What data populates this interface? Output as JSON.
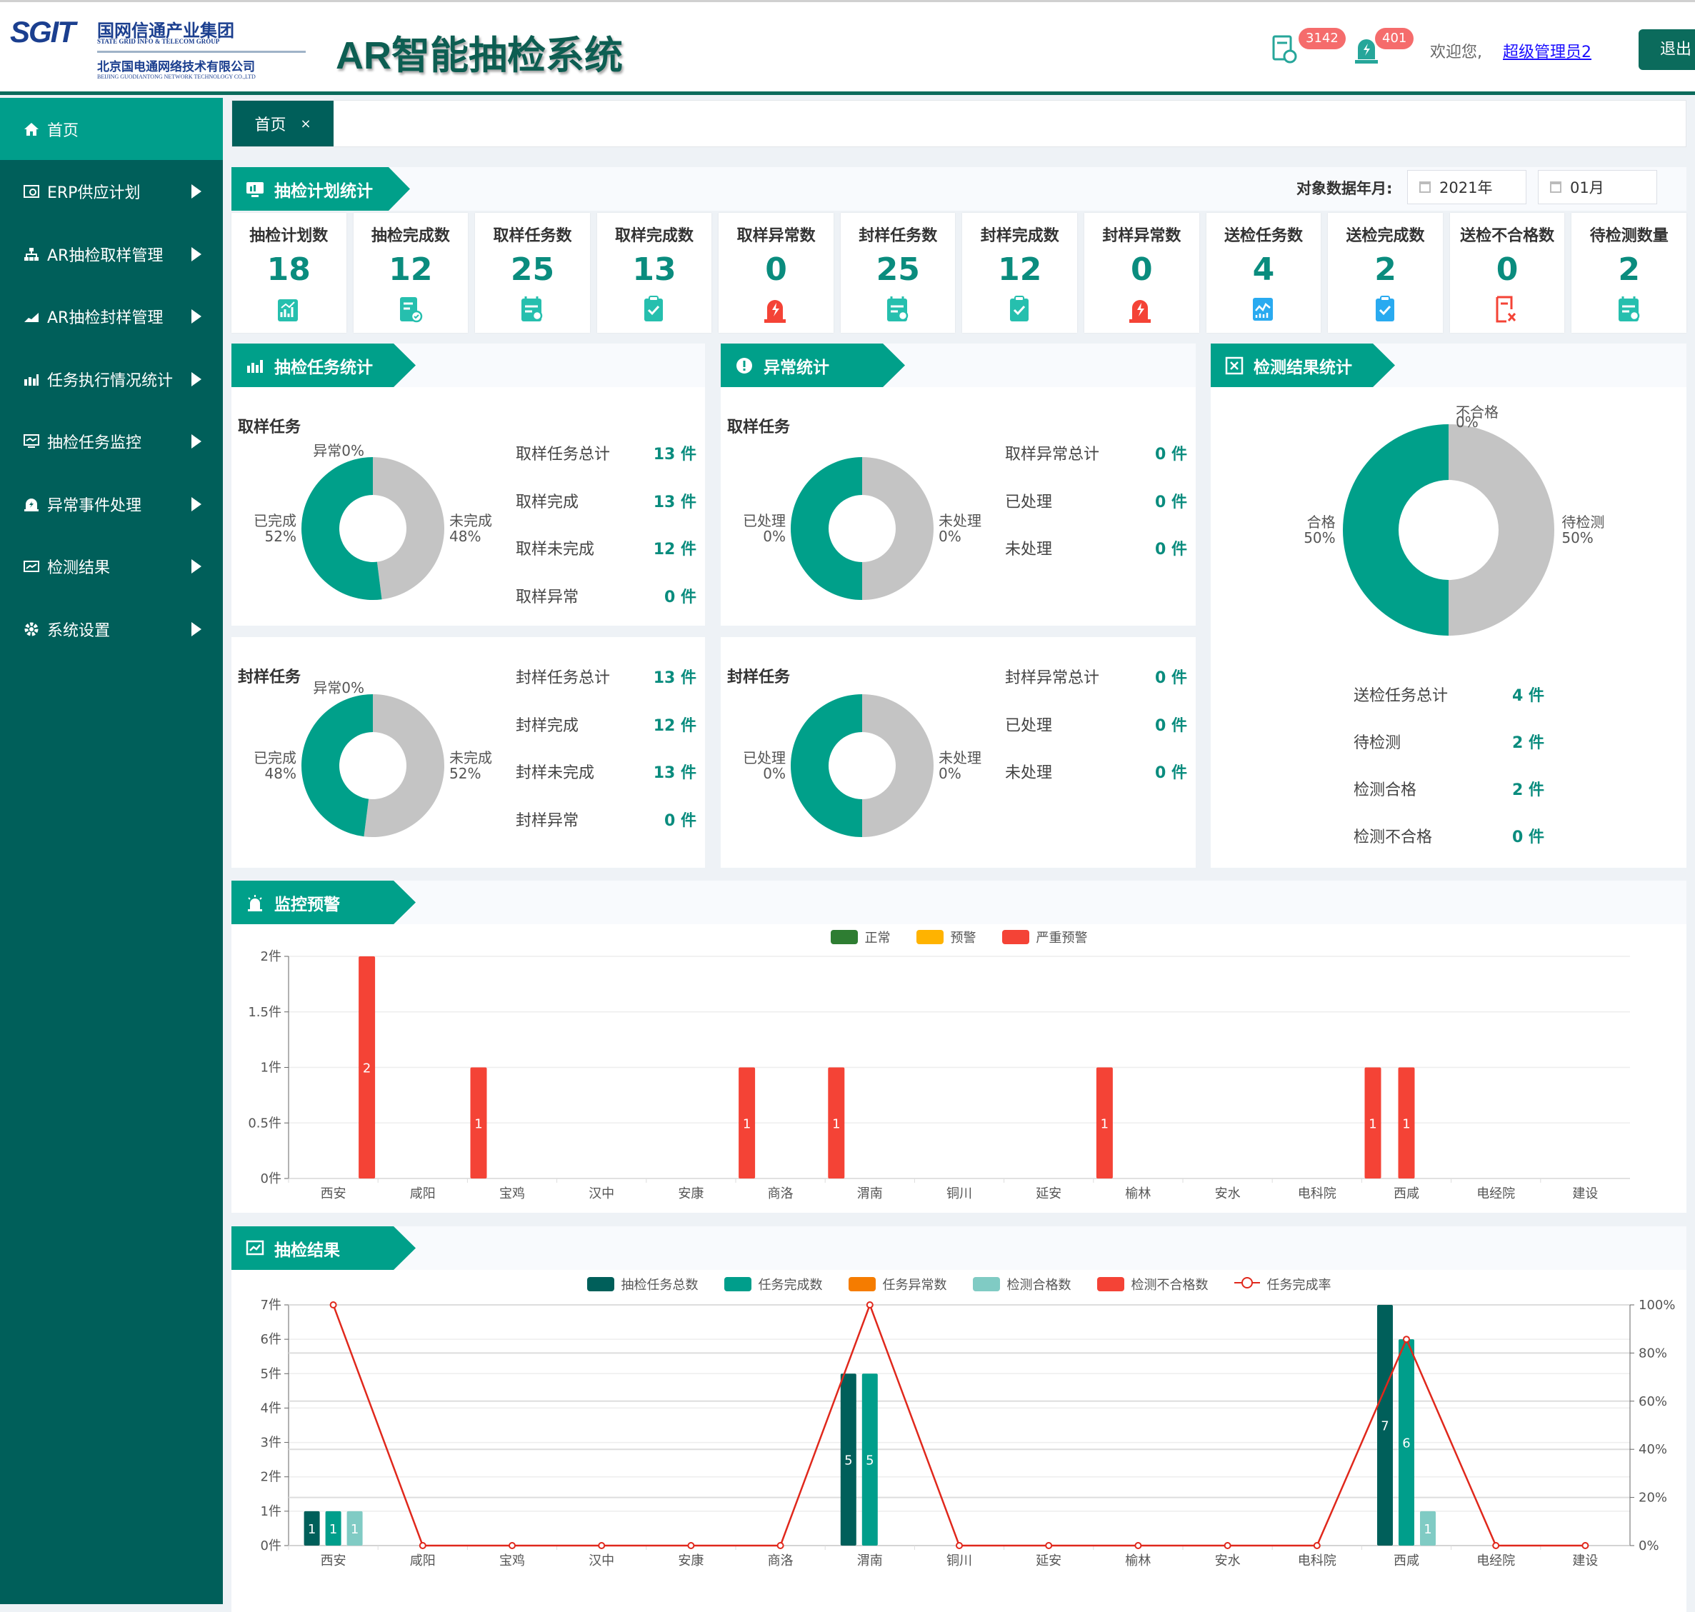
{
  "header": {
    "logo_mark": "SGIT",
    "logo_group_cn": "国网信通产业集团",
    "logo_group_en": "STATE GRID INFO & TELECOM GROUP",
    "logo_company_cn": "北京国电通网络技术有限公司",
    "logo_company_en": "BEIJING GUODIANTONG NETWORK TECHNOLOGY CO.,LTD",
    "title": "AR智能抽检系统",
    "task_badge": "3142",
    "alarm_badge": "401",
    "welcome": "欢迎您,",
    "user": "超级管理员2",
    "logout": "退出"
  },
  "sidebar": {
    "items": [
      {
        "label": "首页",
        "icon": "home-icon",
        "active": true
      },
      {
        "label": "ERP供应计划",
        "icon": "erp-icon"
      },
      {
        "label": "AR抽检取样管理",
        "icon": "org-chart-icon"
      },
      {
        "label": "AR抽检封样管理",
        "icon": "area-chart-icon"
      },
      {
        "label": "任务执行情况统计",
        "icon": "bar-chart-icon"
      },
      {
        "label": "抽检任务监控",
        "icon": "monitor-icon"
      },
      {
        "label": "异常事件处理",
        "icon": "alarm-icon"
      },
      {
        "label": "检测结果",
        "icon": "line-chart-icon"
      },
      {
        "label": "系统设置",
        "icon": "gear-icon"
      }
    ]
  },
  "tabs": [
    {
      "label": "首页",
      "close": "×"
    }
  ],
  "plan_stats": {
    "title": "抽检计划统计",
    "date_label": "对象数据年月:",
    "year": "2021年",
    "month": "01月",
    "cards": [
      {
        "label": "抽检计划数",
        "value": "18",
        "icon": "plan-chart-icon",
        "color": "#26bfae"
      },
      {
        "label": "抽检完成数",
        "value": "12",
        "icon": "doc-check-icon",
        "color": "#26bfae"
      },
      {
        "label": "取样任务数",
        "value": "25",
        "icon": "calendar-icon",
        "color": "#26bfae"
      },
      {
        "label": "取样完成数",
        "value": "13",
        "icon": "clipboard-check-icon",
        "color": "#26bfae"
      },
      {
        "label": "取样异常数",
        "value": "0",
        "icon": "alarm-light-icon",
        "color": "#f44336"
      },
      {
        "label": "封样任务数",
        "value": "25",
        "icon": "calendar-icon",
        "color": "#26bfae"
      },
      {
        "label": "封样完成数",
        "value": "12",
        "icon": "clipboard-check-icon",
        "color": "#26bfae"
      },
      {
        "label": "封样异常数",
        "value": "0",
        "icon": "alarm-light-icon",
        "color": "#f44336"
      },
      {
        "label": "送检任务数",
        "value": "4",
        "icon": "chart-board-icon",
        "color": "#29aaf0"
      },
      {
        "label": "送检完成数",
        "value": "2",
        "icon": "clipboard-check-icon",
        "color": "#29aaf0"
      },
      {
        "label": "送检不合格数",
        "value": "0",
        "icon": "doc-x-icon",
        "color": "#f44336"
      },
      {
        "label": "待检测数量",
        "value": "2",
        "icon": "calendar-icon",
        "color": "#26bfae"
      }
    ]
  },
  "task_stats": {
    "title": "抽检任务统计",
    "blocks": [
      {
        "title": "取样任务",
        "pie": {
          "left_label": "已完成",
          "left_pct": "52%",
          "left_value": 52,
          "right_label": "未完成",
          "right_pct": "48%",
          "right_value": 48,
          "top_label": "异常0%"
        },
        "rows": [
          {
            "label": "取样任务总计",
            "value": "13 件"
          },
          {
            "label": "取样完成",
            "value": "13 件"
          },
          {
            "label": "取样未完成",
            "value": "12 件"
          },
          {
            "label": "取样异常",
            "value": "0 件"
          }
        ]
      },
      {
        "title": "封样任务",
        "pie": {
          "left_label": "已完成",
          "left_pct": "48%",
          "left_value": 48,
          "right_label": "未完成",
          "right_pct": "52%",
          "right_value": 52,
          "top_label": "异常0%"
        },
        "rows": [
          {
            "label": "封样任务总计",
            "value": "13 件"
          },
          {
            "label": "封样完成",
            "value": "12 件"
          },
          {
            "label": "封样未完成",
            "value": "13 件"
          },
          {
            "label": "封样异常",
            "value": "0 件"
          }
        ]
      }
    ]
  },
  "anomaly_stats": {
    "title": "异常统计",
    "blocks": [
      {
        "title": "取样任务",
        "pie": {
          "left_label": "已处理",
          "left_pct": "0%",
          "left_value": 50,
          "right_label": "未处理",
          "right_pct": "0%",
          "right_value": 50,
          "top_label": ""
        },
        "rows": [
          {
            "label": "取样异常总计",
            "value": "0 件"
          },
          {
            "label": "已处理",
            "value": "0 件"
          },
          {
            "label": "未处理",
            "value": "0 件"
          }
        ]
      },
      {
        "title": "封样任务",
        "pie": {
          "left_label": "已处理",
          "left_pct": "0%",
          "left_value": 50,
          "right_label": "未处理",
          "right_pct": "0%",
          "right_value": 50,
          "top_label": ""
        },
        "rows": [
          {
            "label": "封样异常总计",
            "value": "0 件"
          },
          {
            "label": "已处理",
            "value": "0 件"
          },
          {
            "label": "未处理",
            "value": "0 件"
          }
        ]
      }
    ]
  },
  "result_stats": {
    "title": "检测结果统计",
    "pie": {
      "left_label": "合格",
      "left_pct": "50%",
      "left_value": 50,
      "right_label": "待检测",
      "right_pct": "50%",
      "right_value": 50,
      "top_label": "不合格",
      "top_pct": "0%"
    },
    "rows": [
      {
        "label": "送检任务总计",
        "value": "4 件"
      },
      {
        "label": "待检测",
        "value": "2 件"
      },
      {
        "label": "检测合格",
        "value": "2 件"
      },
      {
        "label": "检测不合格",
        "value": "0 件"
      }
    ]
  },
  "colors": {
    "primary": "#00a08a",
    "dark": "#005f5a",
    "pie_gray": "#c4c4c4",
    "bar_red": "#f44336"
  },
  "chart_data": [
    {
      "title": "监控预警",
      "type": "bar",
      "categories": [
        "西安",
        "咸阳",
        "宝鸡",
        "汉中",
        "安康",
        "商洛",
        "渭南",
        "铜川",
        "延安",
        "榆林",
        "安水",
        "电科院",
        "西咸",
        "电经院",
        "建设"
      ],
      "ylim": [
        0,
        2
      ],
      "yticks": [
        "0件",
        "0.5件",
        "1件",
        "1.5件",
        "2件"
      ],
      "legend_position": "top",
      "series": [
        {
          "name": "正常",
          "color": "#2e7d32",
          "values": [
            0,
            0,
            1,
            0,
            0,
            1,
            1,
            0,
            0,
            1,
            0,
            0,
            1,
            0,
            0
          ]
        },
        {
          "name": "预警",
          "color": "#ffb300",
          "values": [
            0,
            0,
            0,
            0,
            0,
            0,
            0,
            0,
            0,
            0,
            0,
            0,
            1,
            0,
            0
          ]
        },
        {
          "name": "严重预警",
          "color": "#f44336",
          "values": [
            2,
            0,
            0,
            0,
            0,
            0,
            0,
            0,
            0,
            0,
            0,
            0,
            0,
            0,
            0
          ]
        }
      ]
    },
    {
      "title": "抽检结果",
      "type": "bar",
      "categories": [
        "西安",
        "咸阳",
        "宝鸡",
        "汉中",
        "安康",
        "商洛",
        "渭南",
        "铜川",
        "延安",
        "榆林",
        "安水",
        "电科院",
        "西咸",
        "电经院",
        "建设"
      ],
      "ylim": [
        0,
        7
      ],
      "yticks": [
        "0件",
        "1件",
        "2件",
        "3件",
        "4件",
        "5件",
        "6件",
        "7件"
      ],
      "y2lim": [
        0,
        100
      ],
      "y2ticks": [
        "0%",
        "20%",
        "40%",
        "60%",
        "80%",
        "100%"
      ],
      "legend_position": "top",
      "series": [
        {
          "name": "抽检任务总数",
          "color": "#005f5a",
          "values": [
            1,
            0,
            0,
            0,
            0,
            0,
            5,
            0,
            0,
            0,
            0,
            0,
            7,
            0,
            0
          ]
        },
        {
          "name": "任务完成数",
          "color": "#009e8b",
          "values": [
            1,
            0,
            0,
            0,
            0,
            0,
            5,
            0,
            0,
            0,
            0,
            0,
            6,
            0,
            0
          ]
        },
        {
          "name": "任务异常数",
          "color": "#f57c00",
          "values": [
            0,
            0,
            0,
            0,
            0,
            0,
            0,
            0,
            0,
            0,
            0,
            0,
            0,
            0,
            0
          ]
        },
        {
          "name": "检测合格数",
          "color": "#80cbc4",
          "values": [
            1,
            0,
            0,
            0,
            0,
            0,
            0,
            0,
            0,
            0,
            0,
            0,
            1,
            0,
            0
          ]
        },
        {
          "name": "检测不合格数",
          "color": "#f44336",
          "values": [
            0,
            0,
            0,
            0,
            0,
            0,
            0,
            0,
            0,
            0,
            0,
            0,
            0,
            0,
            0
          ]
        }
      ],
      "line": {
        "name": "任务完成率",
        "color": "#e0281c",
        "values": [
          100,
          0,
          0,
          0,
          0,
          0,
          100,
          0,
          0,
          0,
          0,
          0,
          85.7,
          0,
          0
        ]
      }
    }
  ]
}
